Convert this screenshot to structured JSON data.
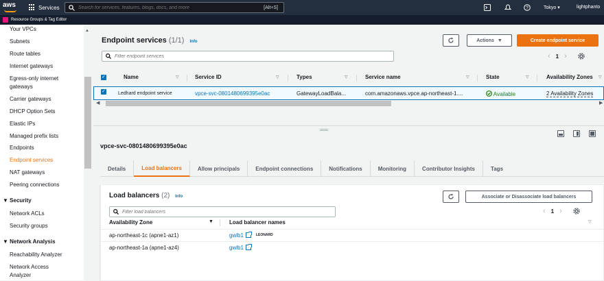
{
  "topbar": {
    "logo": "aws",
    "services": "Services",
    "search_placeholder": "Search for services, features, blogs, docs, and more",
    "search_shortcut": "[Alt+S]",
    "region": "Tokyo",
    "user": "lightphanto"
  },
  "subbar": {
    "label": "Resource Groups & Tag Editor"
  },
  "sidebar": {
    "items": [
      "Your VPCs",
      "Subnets",
      "Route tables",
      "Internet gateways",
      "Egress-only internet",
      "gateways",
      "Carrier gateways",
      "DHCP Option Sets",
      "Elastic IPs",
      "Managed prefix lists",
      "Endpoints",
      "Endpoint services",
      "NAT gateways",
      "Peering connections"
    ],
    "security_title": "Security",
    "security_items": [
      "Network ACLs",
      "Security groups"
    ],
    "network_title": "Network Analysis",
    "network_items": [
      "Reachability Analyzer",
      "Network Access",
      "Analyzer"
    ]
  },
  "main": {
    "title": "Endpoint services",
    "count": "(1/1)",
    "info": "Info",
    "actions": "Actions",
    "create": "Create endpoint service",
    "filter_placeholder": "Filter endpoint services",
    "page": "1",
    "columns": [
      "Name",
      "Service ID",
      "Types",
      "Service name",
      "State",
      "Availability Zones"
    ],
    "row": {
      "name": "Ledhard endpoint service",
      "service_id": "vpce-svc-0801480699395e0ac",
      "types": "GatewayLoadBala...",
      "service_name": "com.amazonaws.vpce.ap-northeast-1....",
      "state": "Available",
      "azs": "2 Availability Zones"
    }
  },
  "detail": {
    "title": "vpce-svc-0801480699395e0ac",
    "tabs": [
      "Details",
      "Load balancers",
      "Allow principals",
      "Endpoint connections",
      "Notifications",
      "Monitoring",
      "Contributor Insights",
      "Tags"
    ],
    "lb": {
      "title": "Load balancers",
      "count": "(2)",
      "info": "Info",
      "assoc": "Associate or Disassociate load balancers",
      "filter_placeholder": "Filter load balancers",
      "page": "1",
      "col_az": "Availability Zone",
      "col_names": "Load balancer names",
      "rows": [
        {
          "az": "ap-northeast-1c (apne1-az1)",
          "name": "gwlb1",
          "note": "LEONARD"
        },
        {
          "az": "ap-northeast-1a (apne1-az4)",
          "name": "gwlb1",
          "note": ""
        }
      ]
    }
  }
}
